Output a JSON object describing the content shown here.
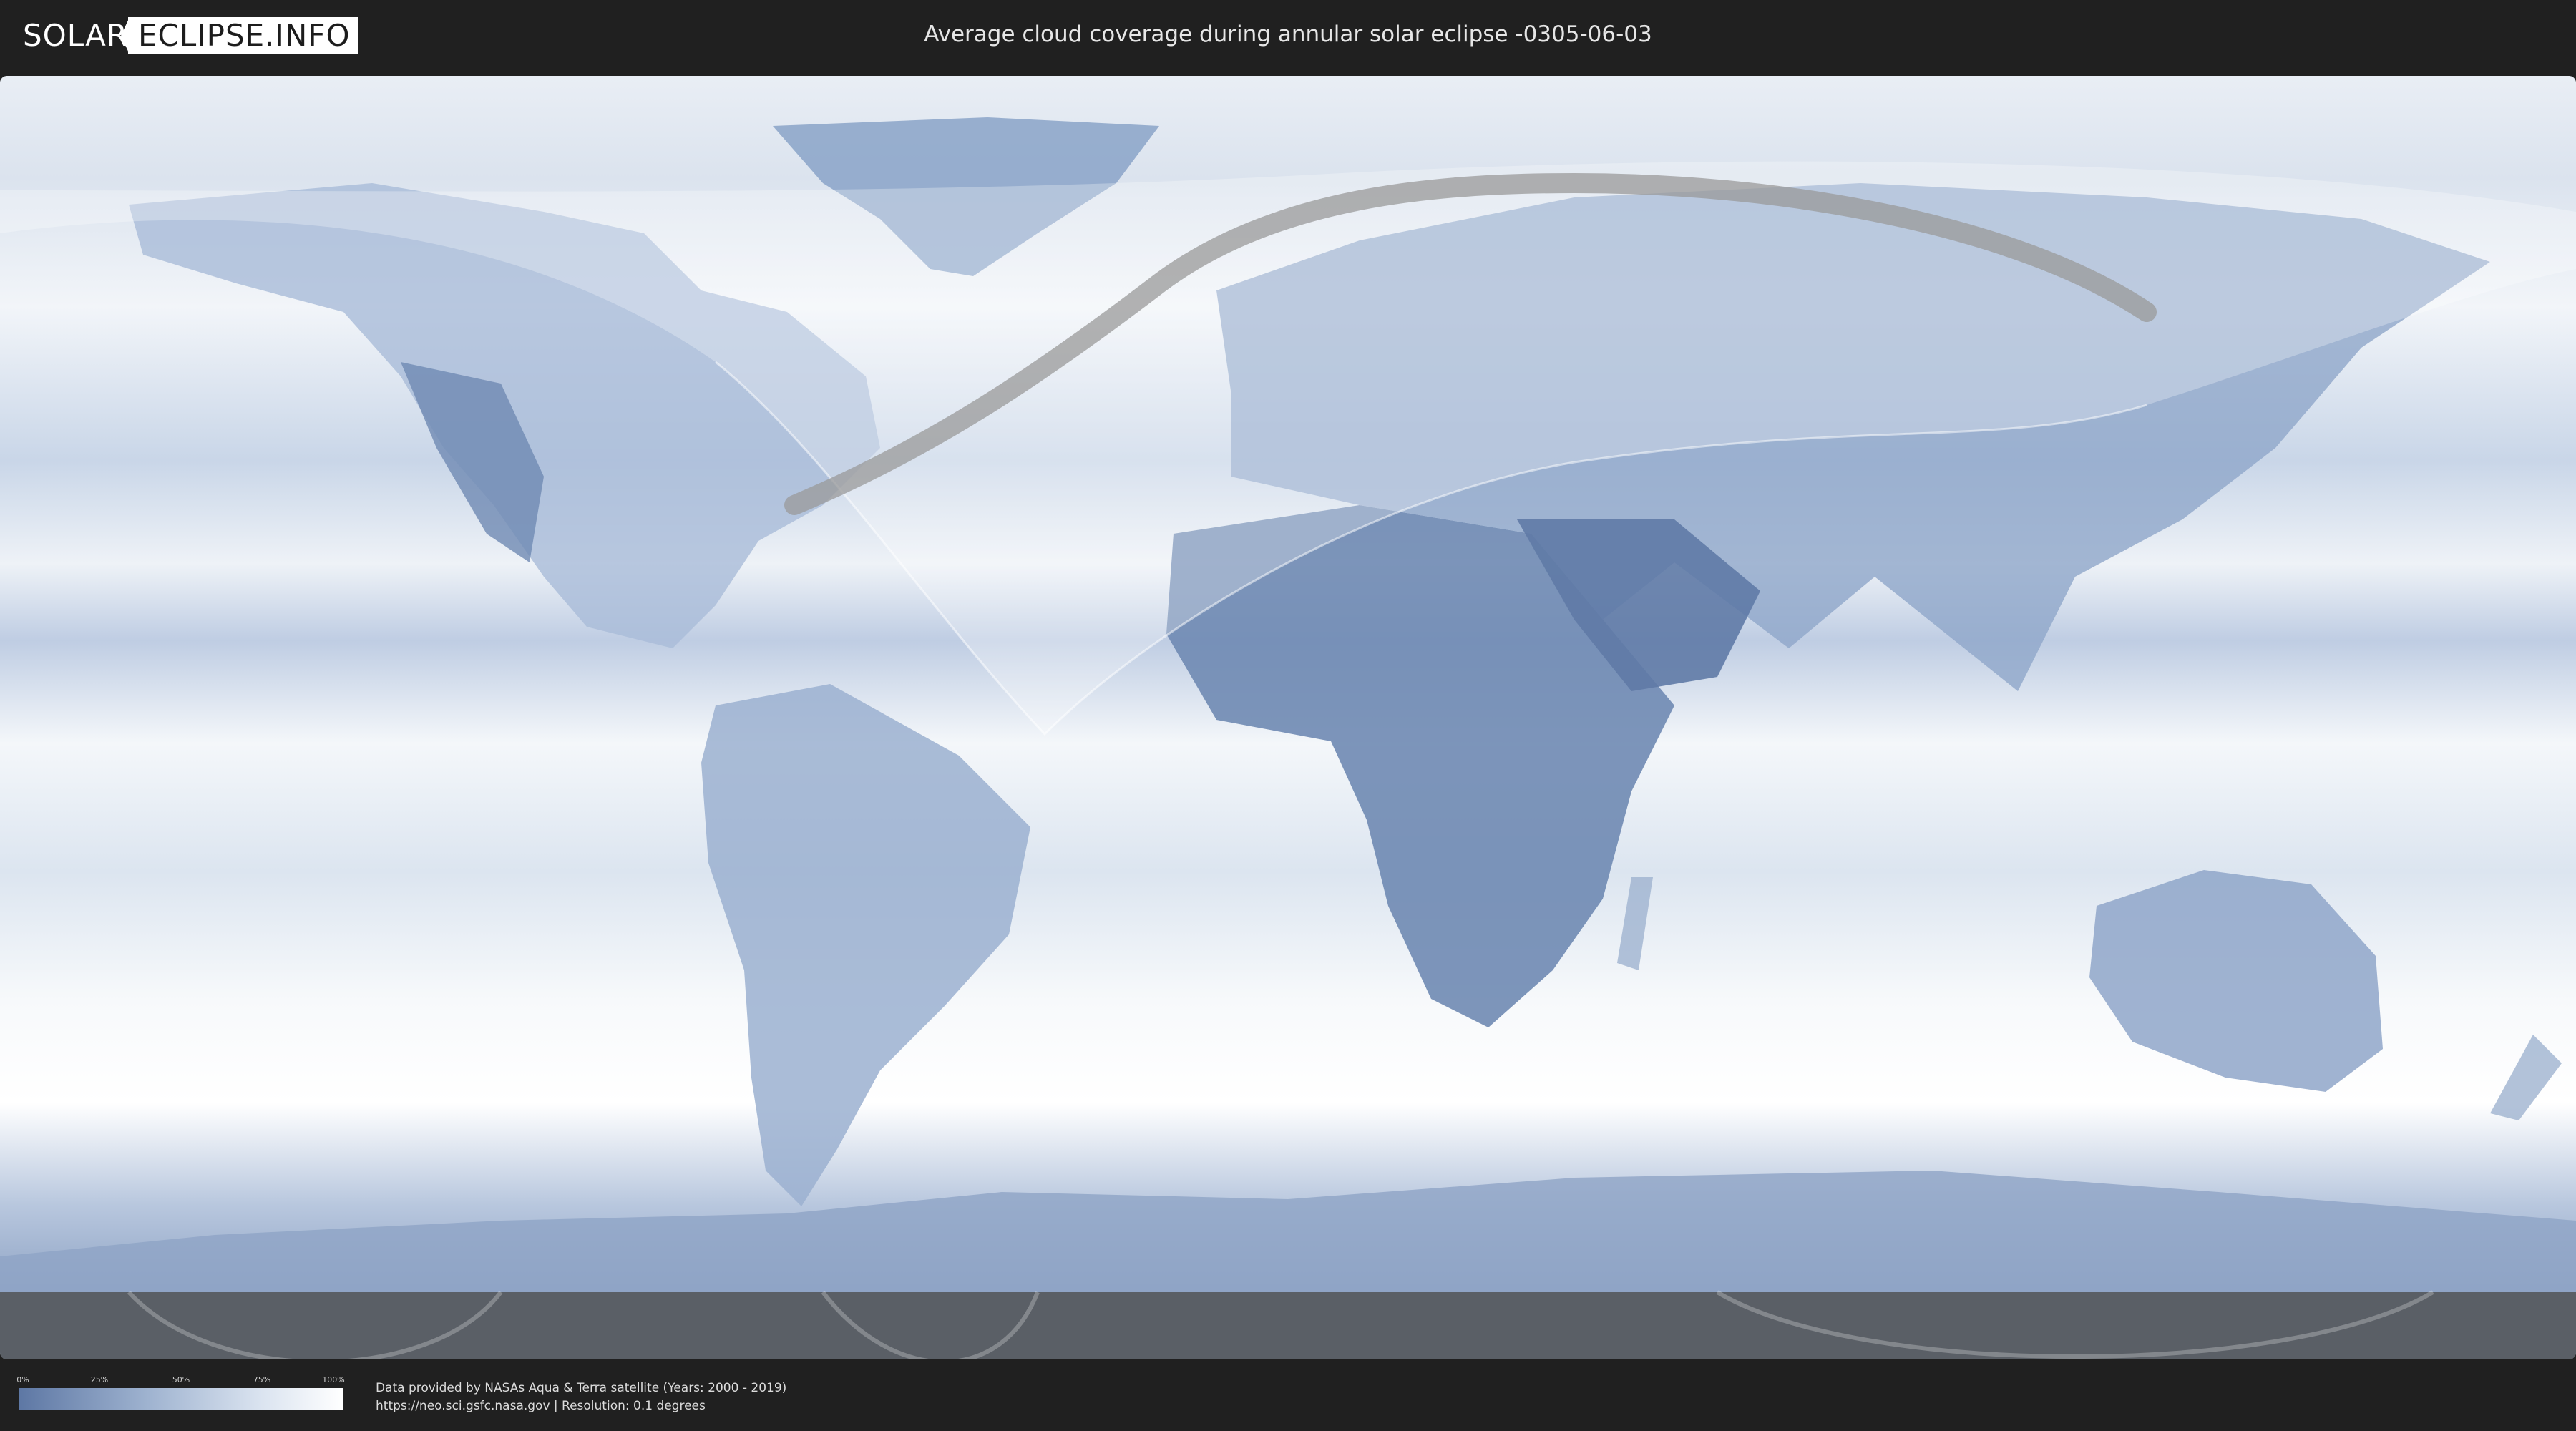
{
  "header": {
    "logo_left": "SOLAR",
    "logo_right": "ECLIPSE.INFO",
    "title": "Average cloud coverage during annular solar eclipse -0305-06-03"
  },
  "map": {
    "base_color": "#dfe7f0",
    "land_color": "#7f97bd",
    "path_color": "#9a9a9a",
    "visibility_overlay_color": "#ffffff",
    "border_color": "#8a9bb3"
  },
  "legend": {
    "ticks": [
      "0%",
      "25%",
      "50%",
      "75%",
      "100%"
    ],
    "gradient_start": "#5d77a4",
    "gradient_end": "#ffffff"
  },
  "credits": {
    "line1": "Data provided by NASAs Aqua & Terra satellite (Years: 2000 - 2019)",
    "line2": "https://neo.sci.gsfc.nasa.gov | Resolution: 0.1 degrees"
  }
}
